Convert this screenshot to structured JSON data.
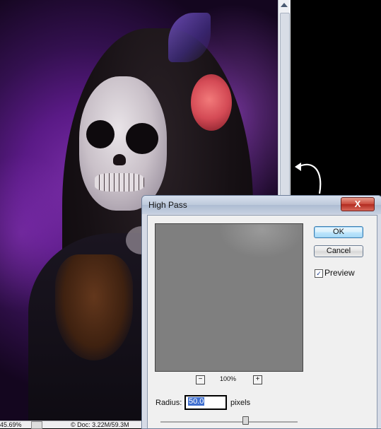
{
  "canvas": {
    "alt": "sugar skull portrait photo"
  },
  "status_bar": {
    "zoom": "45.69%",
    "doc": "© Doc: 3.22M/59.3M"
  },
  "dialog": {
    "title": "High Pass",
    "close_glyph": "X",
    "ok_label": "OK",
    "cancel_label": "Cancel",
    "preview_label": "Preview",
    "preview_checked": true,
    "check_glyph": "✓",
    "zoom_minus": "−",
    "zoom_level": "100%",
    "zoom_plus": "+",
    "radius_label": "Radius:",
    "radius_value": "50.0",
    "radius_unit": "pixels"
  },
  "colors": {
    "accent_ok": "#3c7fb1",
    "close_red": "#c9483a",
    "selection": "#3f6fcf"
  },
  "icons": {
    "curl": "curved-arrow-icon",
    "scroll": "scroll-up-arrow-icon"
  }
}
